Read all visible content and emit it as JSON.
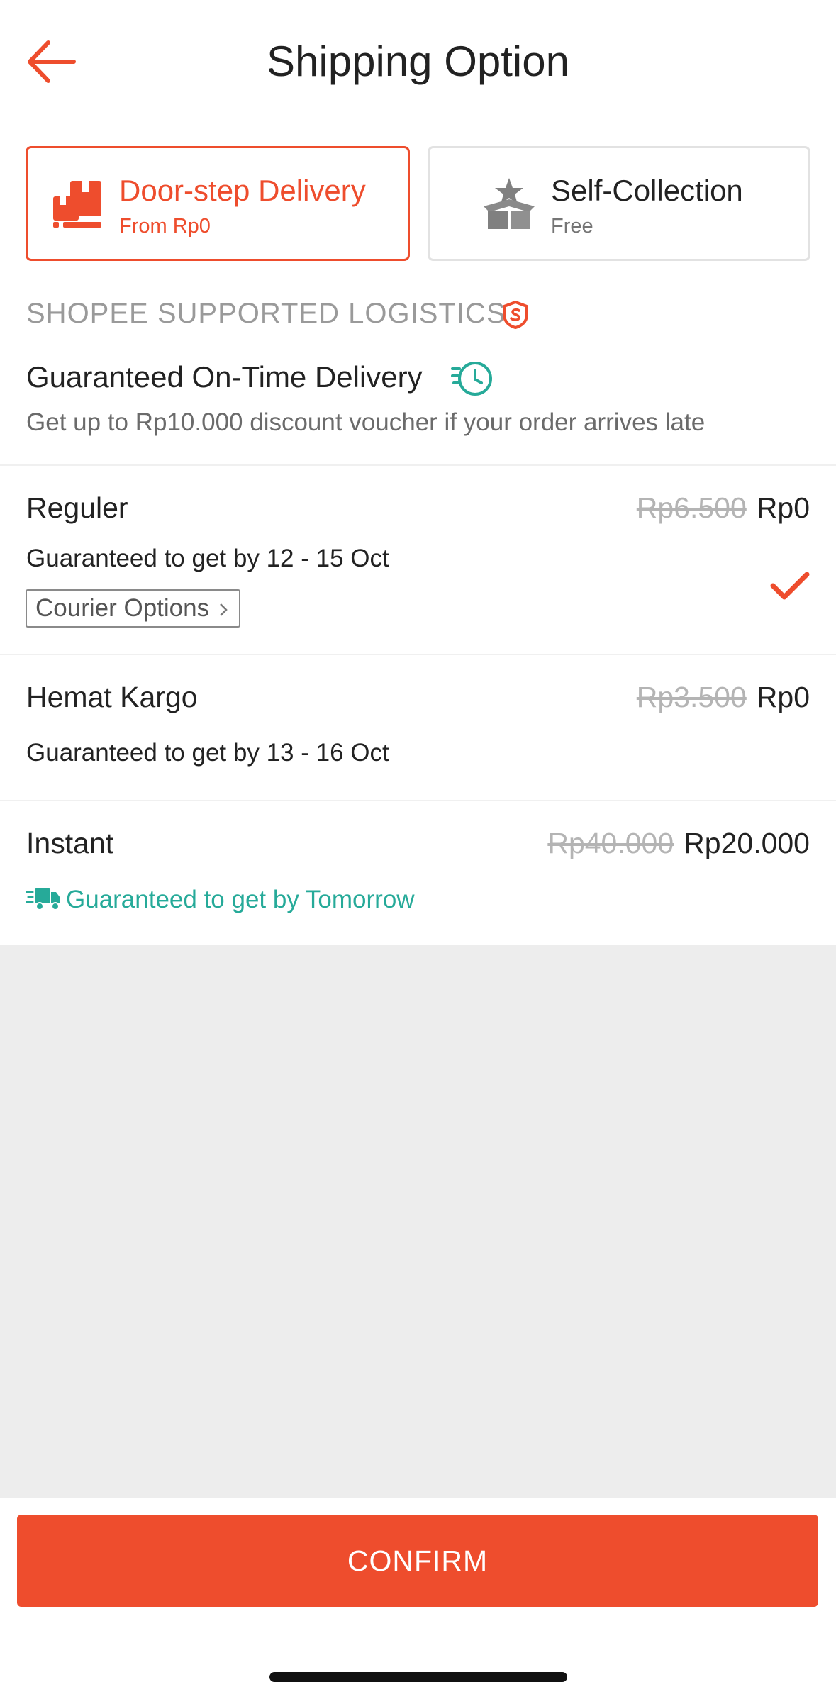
{
  "header": {
    "title": "Shipping Option",
    "back_icon": "arrow-left-icon"
  },
  "delivery_methods": [
    {
      "name": "Door-step Delivery",
      "sub": "From Rp0",
      "icon": "parcel-icon",
      "selected": true
    },
    {
      "name": "Self-Collection",
      "sub": "Free",
      "icon": "box-star-icon",
      "selected": false
    }
  ],
  "logistics": {
    "section_label": "SHOPEE SUPPORTED LOGISTICS",
    "section_icon": "shield-icon",
    "guarantee_title": "Guaranteed On-Time Delivery",
    "guarantee_icon": "clock-icon",
    "guarantee_desc": "Get up to Rp10.000 discount voucher if your order arrives late"
  },
  "options": [
    {
      "name": "Reguler",
      "old_price": "Rp6.500",
      "price": "Rp0",
      "eta": "Guaranteed to get by 12 - 15 Oct",
      "courier_label": "Courier Options",
      "selected": true
    },
    {
      "name": "Hemat Kargo",
      "old_price": "Rp3.500",
      "price": "Rp0",
      "eta": "Guaranteed to get by 13 - 16 Oct",
      "selected": false
    },
    {
      "name": "Instant",
      "old_price": "Rp40.000",
      "price": "Rp20.000",
      "eta": "Guaranteed to get by Tomorrow",
      "eta_icon": "truck-icon",
      "selected": false
    }
  ],
  "footer": {
    "confirm_label": "CONFIRM"
  },
  "colors": {
    "accent": "#ee4d2d",
    "teal": "#26aa99",
    "muted": "#9a9a9a",
    "background": "#ededed"
  }
}
